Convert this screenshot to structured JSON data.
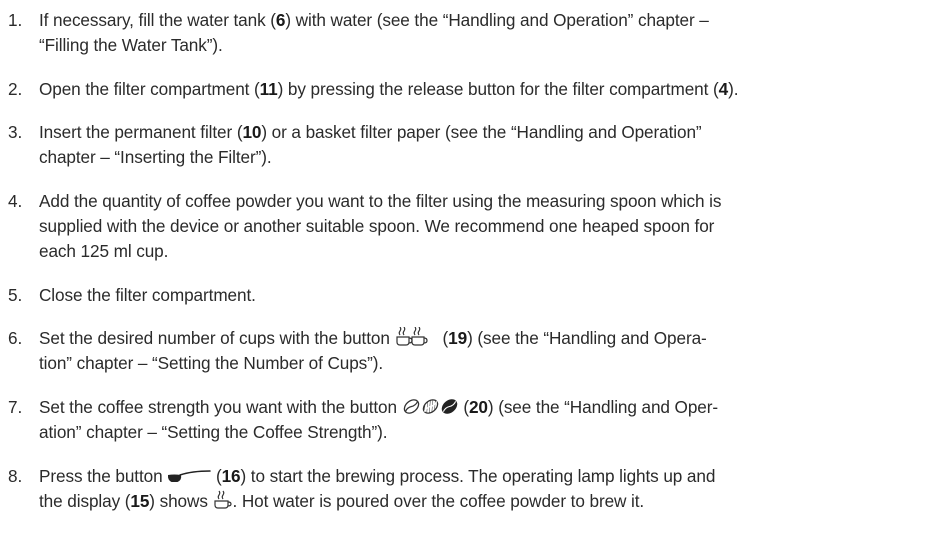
{
  "steps": [
    {
      "num": "1.",
      "lines": [
        [
          "If necessary, fill the water tank (",
          "6",
          ") with water (see the “Handling and Operation” chapter –"
        ],
        [
          "“Filling the Water Tank”)."
        ]
      ]
    },
    {
      "num": "2.",
      "lines": [
        [
          "Open the filter compartment (",
          "11",
          ") by pressing the release button for the filter compartment (",
          "4",
          ")."
        ]
      ]
    },
    {
      "num": "3.",
      "lines": [
        [
          "Insert the permanent filter (",
          "10",
          ") or a basket filter paper (see the “Handling and Operation”"
        ],
        [
          "chapter – “Inserting the Filter”)."
        ]
      ]
    },
    {
      "num": "4.",
      "lines": [
        [
          "Add the quantity of coffee powder you want to the filter using the measuring spoon which is"
        ],
        [
          "supplied with the device or another suitable spoon. We recommend one heaped spoon for"
        ],
        [
          "each 125 ml cup."
        ]
      ]
    },
    {
      "num": "5.",
      "lines": [
        [
          "Close the filter compartment."
        ]
      ]
    },
    {
      "num": "6.",
      "lines": [
        [
          "Set the desired number of cups with the button",
          "(",
          "19",
          ") (see the “Handling and Opera-"
        ],
        [
          "tion” chapter – “Setting the Number of Cups”)."
        ]
      ]
    },
    {
      "num": "7.",
      "lines": [
        [
          "Set the coffee strength you want with the button",
          "(",
          "20",
          ") (see the “Handling and Oper-"
        ],
        [
          "ation” chapter – “Setting the Coffee Strength”)."
        ]
      ]
    },
    {
      "num": "8.",
      "lines": [
        [
          "Press the button",
          "(",
          "16",
          ") to start the brewing process. The operating lamp lights up and"
        ],
        [
          "the display (",
          "15",
          ") shows",
          ". Hot water is poured over the coffee powder to brew it."
        ]
      ]
    }
  ],
  "icons": {
    "step6_button": "two-cups-icon",
    "step7_buttons": [
      "bean-outline-icon",
      "bean-hatched-icon",
      "bean-filled-icon"
    ],
    "step8_button": "spoon-icon",
    "step8_display": "steaming-cup-icon"
  }
}
